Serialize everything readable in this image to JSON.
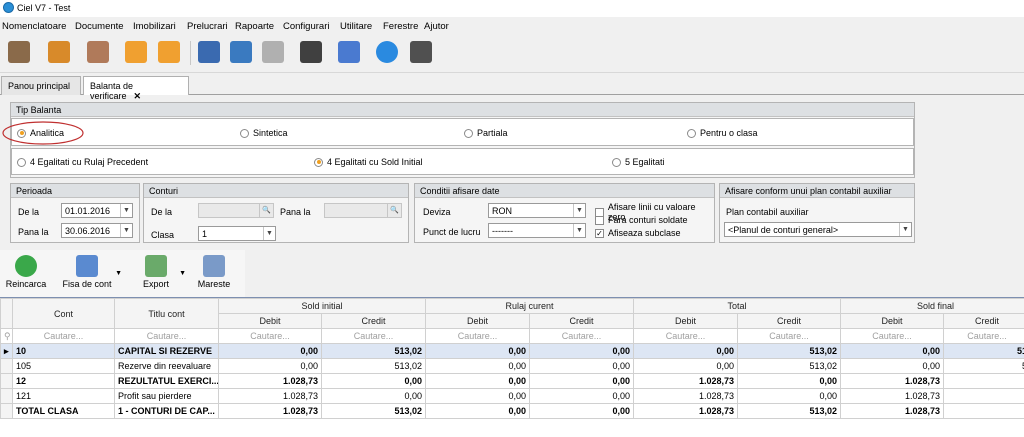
{
  "window": {
    "title": "Ciel V7 - Test"
  },
  "menu": [
    "Nomenclatoare",
    "Documente",
    "Imobilizari",
    "Prelucrari",
    "Rapoarte",
    "Configurari",
    "Utilitare",
    "Ferestre",
    "Ajutor"
  ],
  "tabs": [
    {
      "label": "Panou principal"
    },
    {
      "label": "Balanta de verificare"
    }
  ],
  "tip_balanta": {
    "title": "Tip Balanta",
    "row1": [
      "Analitica",
      "Sintetica",
      "Partiala",
      "Pentru o clasa"
    ],
    "row2": [
      "4 Egalitati cu Rulaj Precedent",
      "4 Egalitati cu Sold Initial",
      "5 Egalitati"
    ],
    "selected_row1": "Analitica",
    "selected_row2": "4 Egalitati cu Sold Initial"
  },
  "perioada": {
    "title": "Perioada",
    "de_la_label": "De la",
    "de_la": "01.01.2016",
    "pana_la_label": "Pana la",
    "pana_la": "30.06.2016"
  },
  "conturi": {
    "title": "Conturi",
    "de_la_label": "De la",
    "pana_la_label": "Pana la",
    "clasa_label": "Clasa",
    "clasa": "1"
  },
  "conditii": {
    "title": "Conditii afisare date",
    "deviza_label": "Deviza",
    "deviza": "RON",
    "punct_label": "Punct de lucru",
    "punct": "-------",
    "checks": [
      {
        "label": "Afisare linii cu valoare zero",
        "checked": false
      },
      {
        "label": "Fara conturi soldate",
        "checked": false
      },
      {
        "label": "Afiseaza subclase",
        "checked": true
      }
    ]
  },
  "plan_aux": {
    "title": "Afisare conform unui plan contabil auxiliar",
    "label": "Plan contabil auxiliar",
    "value": "<Planul de conturi general>"
  },
  "actions": {
    "reincarca": "Reincarca",
    "fisa": "Fisa de cont",
    "export": "Export",
    "mareste": "Mareste"
  },
  "grid": {
    "h_cont": "Cont",
    "h_titlu": "Titlu cont",
    "groups": [
      "Sold initial",
      "Rulaj curent",
      "Total",
      "Sold final"
    ],
    "sub_debit": "Debit",
    "sub_credit": "Credit",
    "filter": "Cautare...",
    "rows": [
      {
        "cont": "10",
        "titlu": "CAPITAL SI REZERVE",
        "vals": [
          "0,00",
          "513,02",
          "0,00",
          "0,00",
          "0,00",
          "513,02",
          "0,00",
          "51"
        ],
        "bold": true,
        "sel": true
      },
      {
        "cont": "105",
        "titlu": "Rezerve din reevaluare",
        "vals": [
          "0,00",
          "513,02",
          "0,00",
          "0,00",
          "0,00",
          "513,02",
          "0,00",
          "5"
        ],
        "bold": false
      },
      {
        "cont": "12",
        "titlu": "REZULTATUL EXERCI...",
        "vals": [
          "1.028,73",
          "0,00",
          "0,00",
          "0,00",
          "1.028,73",
          "0,00",
          "1.028,73",
          ""
        ],
        "bold": true
      },
      {
        "cont": "121",
        "titlu": "Profit sau pierdere",
        "vals": [
          "1.028,73",
          "0,00",
          "0,00",
          "0,00",
          "1.028,73",
          "0,00",
          "1.028,73",
          ""
        ],
        "bold": false
      },
      {
        "cont": "TOTAL CLASA",
        "titlu": "1 - CONTURI DE CAP...",
        "vals": [
          "1.028,73",
          "513,02",
          "0,00",
          "0,00",
          "1.028,73",
          "513,02",
          "1.028,73",
          ""
        ],
        "bold": true
      }
    ]
  }
}
